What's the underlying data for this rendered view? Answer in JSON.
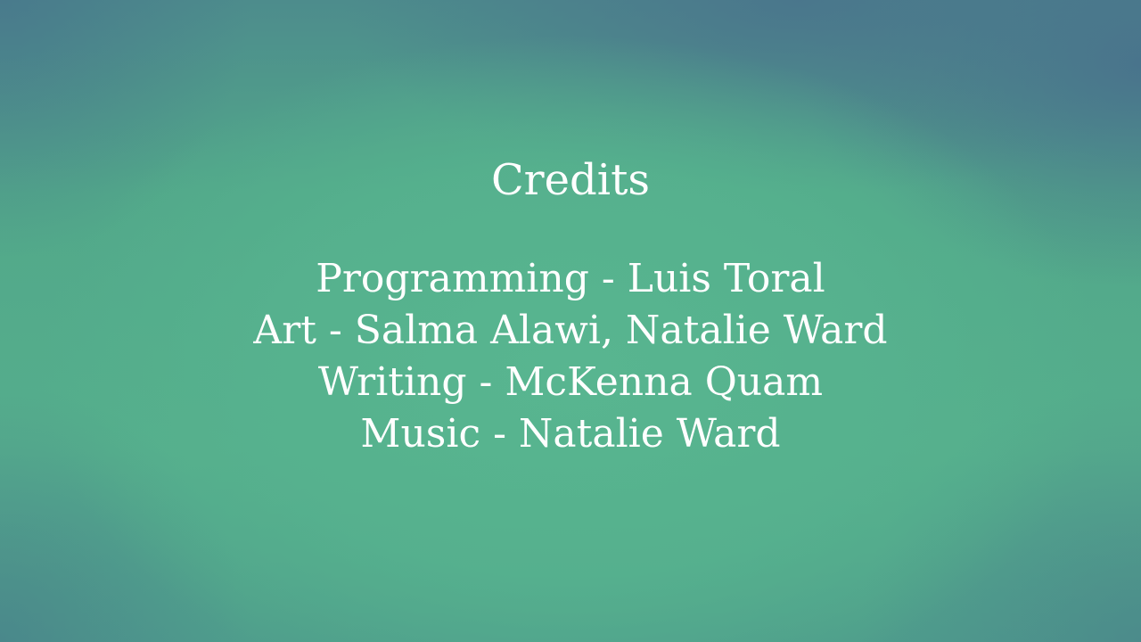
{
  "screen": {
    "title": "Credits",
    "lines": [
      "Programming - Luis Toral",
      "Art - Salma Alawi, Natalie Ward",
      "Writing - McKenna Quam",
      "Music - Natalie Ward"
    ]
  },
  "colors": {
    "background": "#53ab8a",
    "text": "#ffffff"
  }
}
